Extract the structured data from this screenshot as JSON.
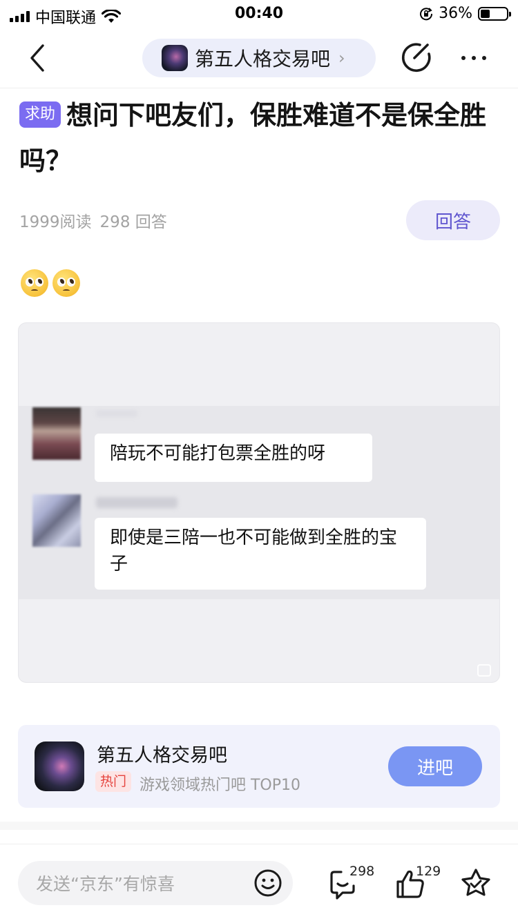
{
  "status_bar": {
    "carrier": "中国联通",
    "time": "00:40",
    "battery_percent": "36%",
    "battery_level": 0.36
  },
  "nav": {
    "forum_name": "第五人格交易吧",
    "chevron": "›"
  },
  "post": {
    "tag": "求助",
    "title": "想问下吧友们，保胜难道不是保全胜吗？",
    "reads": "1999阅读",
    "answers": "298 回答",
    "answer_button": "回答",
    "emojis": [
      "pleading-face-emoji",
      "pleading-face-emoji"
    ]
  },
  "image": {
    "bubble1": "陪玩不可能打包票全胜的呀",
    "bubble2": "即使是三陪一也不可能做到全胜的宝子"
  },
  "forum_card": {
    "name": "第五人格交易吧",
    "badge": "热门",
    "description": "游戏领域热门吧 TOP10",
    "enter_button": "进吧"
  },
  "bottom_bar": {
    "input_placeholder": "发送“京东”有惊喜",
    "comment_count": "298",
    "like_count": "129"
  },
  "colors": {
    "accent_purple": "#7b6cf1",
    "enter_blue": "#7a96f3",
    "hot_red": "#e5433d"
  }
}
